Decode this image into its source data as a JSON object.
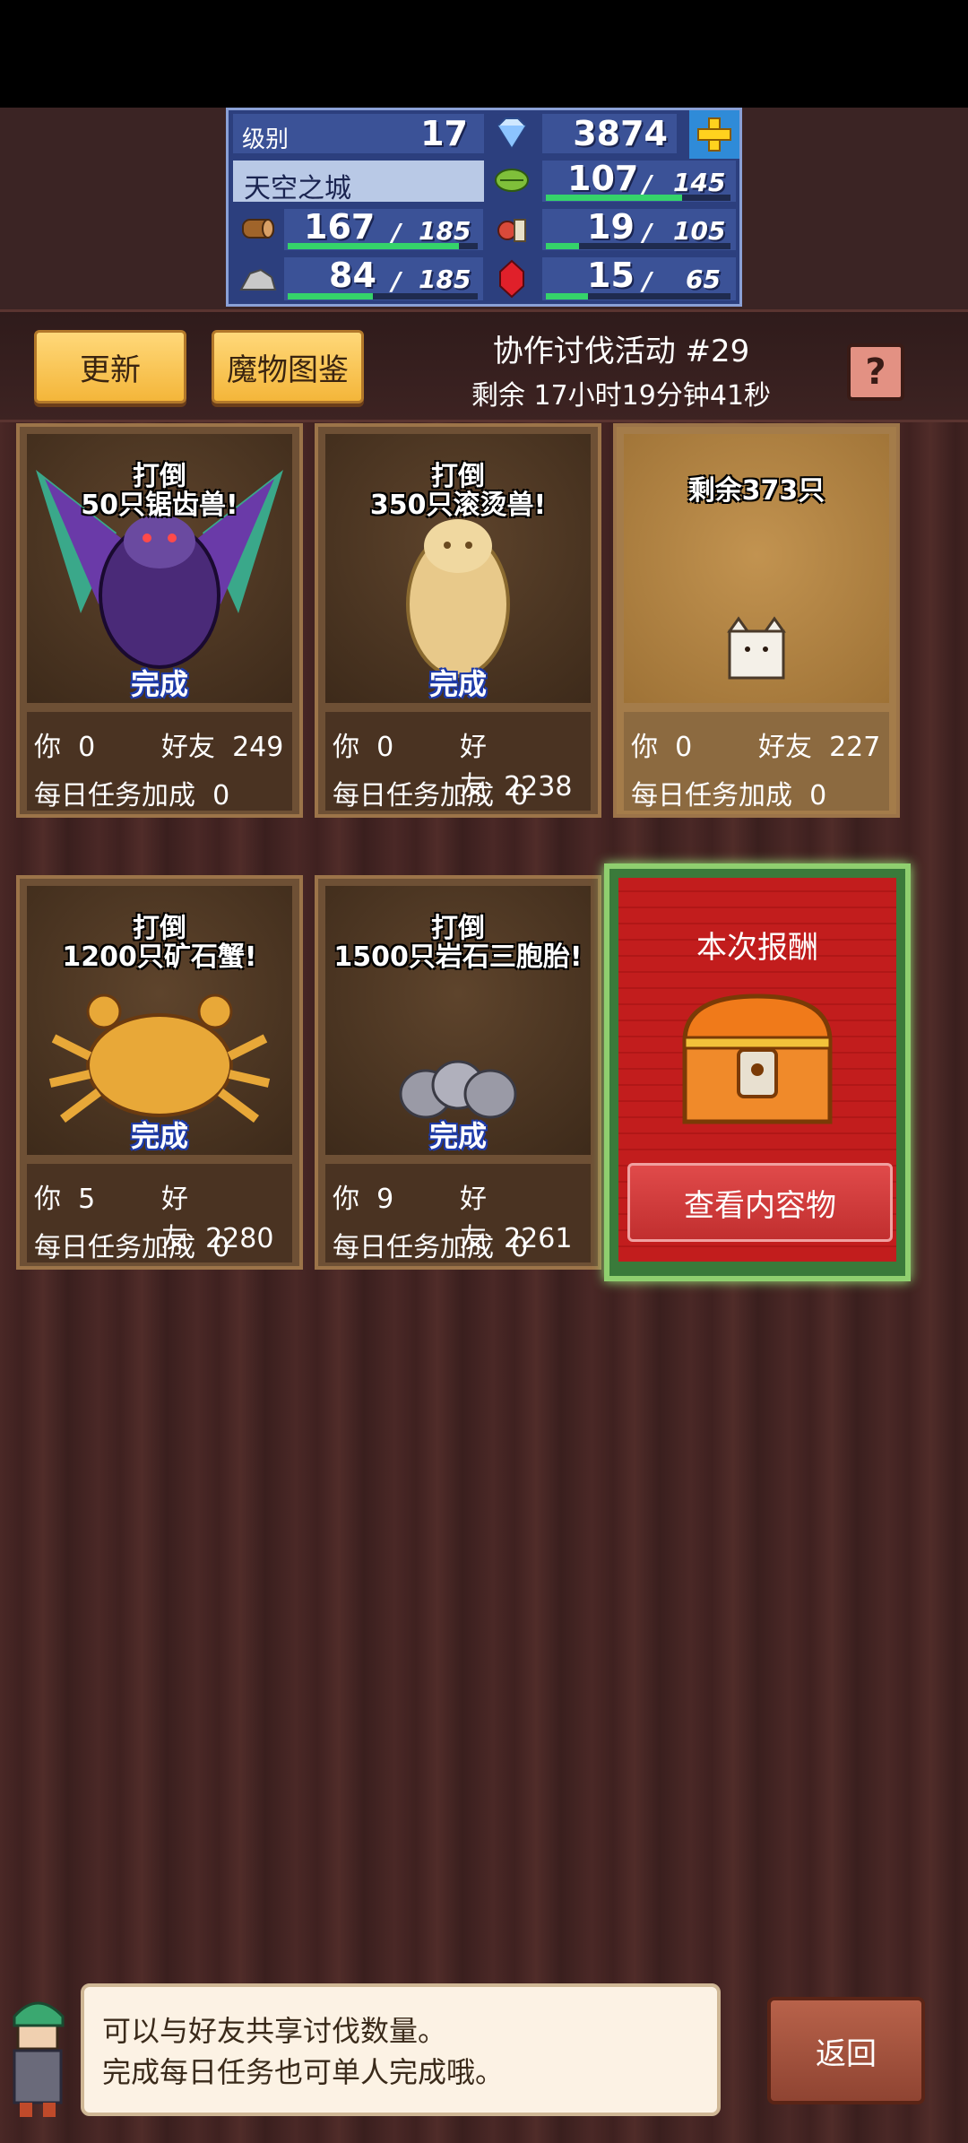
{
  "stats": {
    "level_label": "级别",
    "level": "17",
    "gems": "3874",
    "town_name": "天空之城",
    "food": {
      "value": "107",
      "max": "145",
      "fill": 0.74
    },
    "wood": {
      "value": "167",
      "max": "185",
      "fill": 0.9
    },
    "produce": {
      "value": "19",
      "max": "105",
      "fill": 0.18
    },
    "ore": {
      "value": "84",
      "max": "185",
      "fill": 0.45
    },
    "ruby": {
      "value": "15",
      "max": "65",
      "fill": 0.23
    }
  },
  "header": {
    "update_label": "更新",
    "bestiary_label": "魔物图鉴",
    "event_title": "协作讨伐活动 #29",
    "remaining_time": "剩余 17小时19分钟41秒",
    "help_label": "?"
  },
  "cards": [
    {
      "line1": "打倒",
      "line2": "50只锯齿兽!",
      "status": "完成",
      "you_label": "你",
      "you": "0",
      "friend_label": "好友",
      "friends": "249",
      "bonus_label": "每日任务加成",
      "bonus": "0"
    },
    {
      "line1": "打倒",
      "line2": "350只滚烫兽!",
      "status": "完成",
      "you_label": "你",
      "you": "0",
      "friend_label": "好友",
      "friends": "2238",
      "bonus_label": "每日任务加成",
      "bonus": "0"
    },
    {
      "line1": "剩余373只",
      "line2": "",
      "status": "",
      "you_label": "你",
      "you": "0",
      "friend_label": "好友",
      "friends": "227",
      "bonus_label": "每日任务加成",
      "bonus": "0"
    },
    {
      "line1": "打倒",
      "line2": "1200只矿石蟹!",
      "status": "完成",
      "you_label": "你",
      "you": "5",
      "friend_label": "好友",
      "friends": "2280",
      "bonus_label": "每日任务加成",
      "bonus": "0"
    },
    {
      "line1": "打倒",
      "line2": "1500只岩石三胞胎!",
      "status": "完成",
      "you_label": "你",
      "you": "9",
      "friend_label": "好友",
      "friends": "2261",
      "bonus_label": "每日任务加成",
      "bonus": "0"
    }
  ],
  "reward": {
    "title": "本次报酬",
    "button_label": "查看内容物"
  },
  "dialog": {
    "line1": "可以与好友共享讨伐数量。",
    "line2": "完成每日任务也可单人完成哦。"
  },
  "back_label": "返回"
}
